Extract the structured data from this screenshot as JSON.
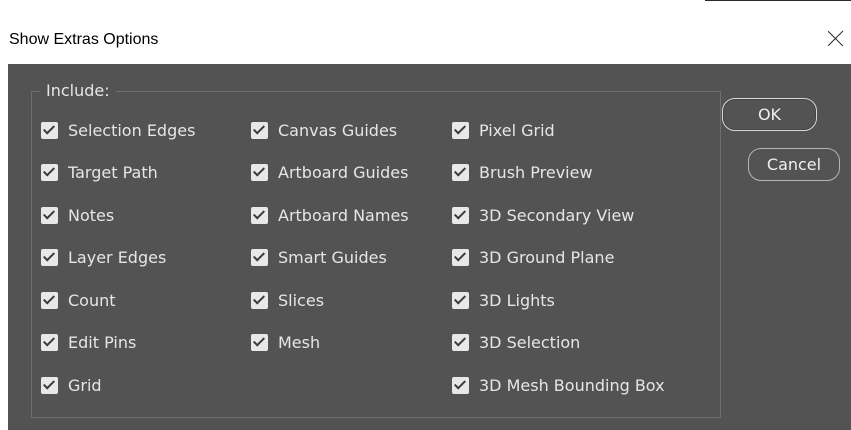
{
  "window": {
    "title": "Show Extras Options",
    "close_icon": "close-icon"
  },
  "group": {
    "legend": "Include:"
  },
  "options": {
    "col1": [
      {
        "label": "Selection Edges",
        "checked": true
      },
      {
        "label": "Target Path",
        "checked": true
      },
      {
        "label": "Notes",
        "checked": true
      },
      {
        "label": "Layer Edges",
        "checked": true
      },
      {
        "label": "Count",
        "checked": true
      },
      {
        "label": "Edit Pins",
        "checked": true
      },
      {
        "label": "Grid",
        "checked": true
      }
    ],
    "col2": [
      {
        "label": "Canvas Guides",
        "checked": true
      },
      {
        "label": "Artboard Guides",
        "checked": true
      },
      {
        "label": "Artboard Names",
        "checked": true
      },
      {
        "label": "Smart Guides",
        "checked": true
      },
      {
        "label": "Slices",
        "checked": true
      },
      {
        "label": "Mesh",
        "checked": true
      }
    ],
    "col3": [
      {
        "label": "Pixel Grid",
        "checked": true
      },
      {
        "label": "Brush Preview",
        "checked": true
      },
      {
        "label": "3D Secondary View",
        "checked": true
      },
      {
        "label": "3D Ground Plane",
        "checked": true
      },
      {
        "label": "3D Lights",
        "checked": true
      },
      {
        "label": "3D Selection",
        "checked": true
      },
      {
        "label": "3D Mesh Bounding Box",
        "checked": true
      }
    ]
  },
  "buttons": {
    "ok": "OK",
    "cancel": "Cancel"
  },
  "colors": {
    "panel_bg": "#535353",
    "text": "#e6e6e6",
    "checkbox": "#e8e8e8"
  }
}
